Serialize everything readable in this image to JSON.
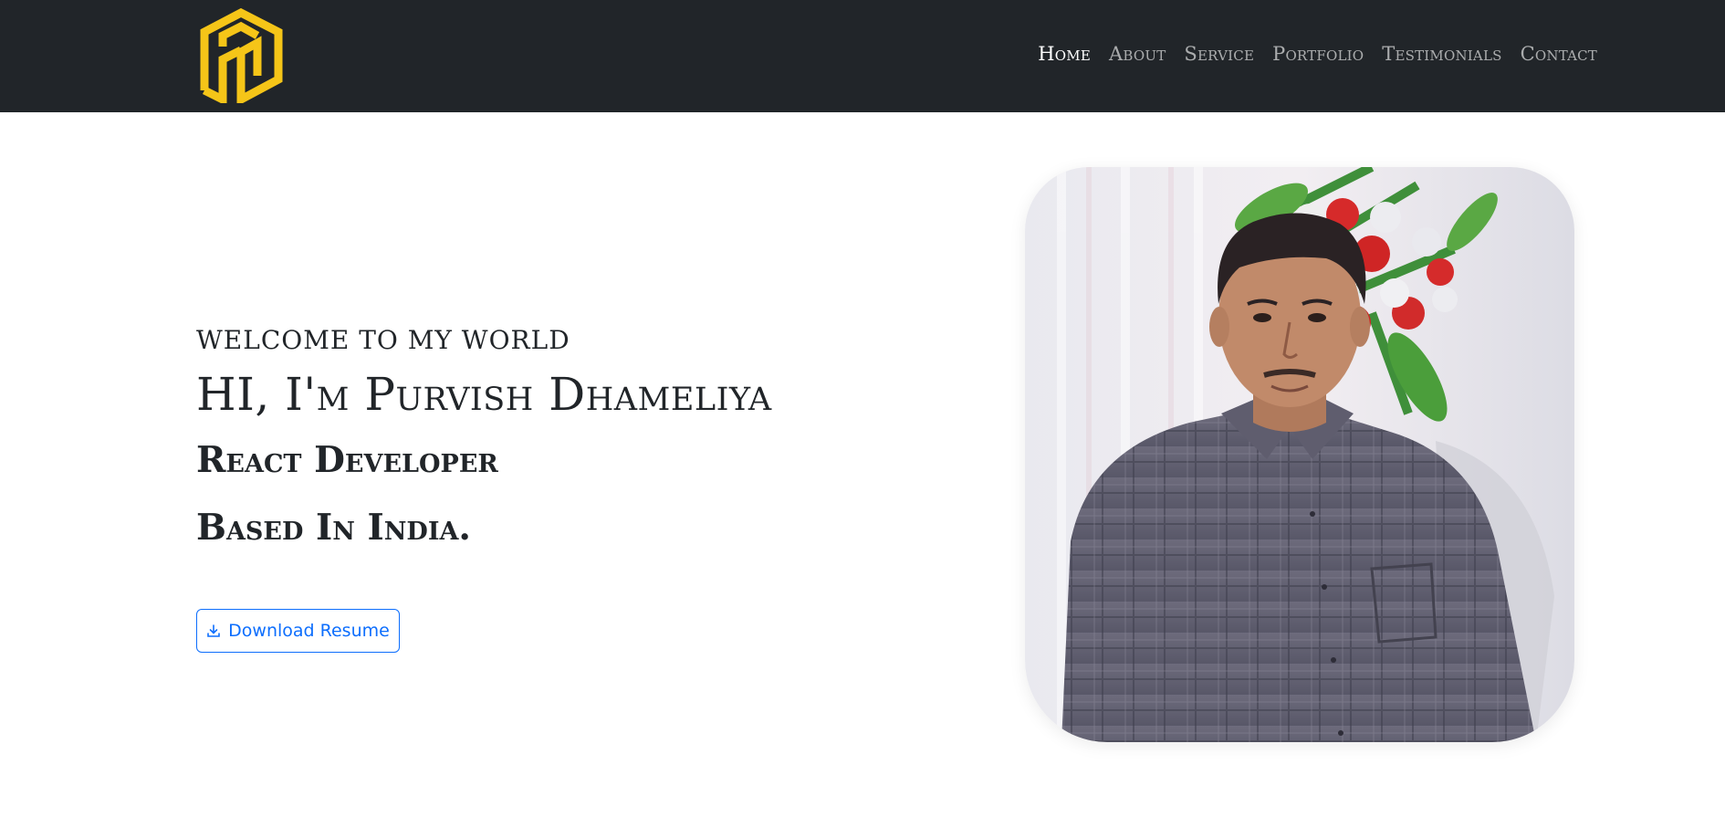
{
  "navbar": {
    "logo_icon": "pd-monogram-logo",
    "brand_color": "#F5C518",
    "background": "#212529",
    "links": [
      {
        "label": "Home",
        "active": true
      },
      {
        "label": "About",
        "active": false
      },
      {
        "label": "Service",
        "active": false
      },
      {
        "label": "Portfolio",
        "active": false
      },
      {
        "label": "Testimonials",
        "active": false
      },
      {
        "label": "Contact",
        "active": false
      }
    ]
  },
  "hero": {
    "welcome": "Welcome to my world",
    "name": "HI, I'm Purvish Dhameliya",
    "role": "React Developer",
    "location": "Based In India.",
    "download_button": {
      "label": "Download Resume",
      "icon": "download-icon",
      "color": "#0d6efd"
    }
  },
  "profile_photo": {
    "description_icon": "portrait-photo"
  }
}
